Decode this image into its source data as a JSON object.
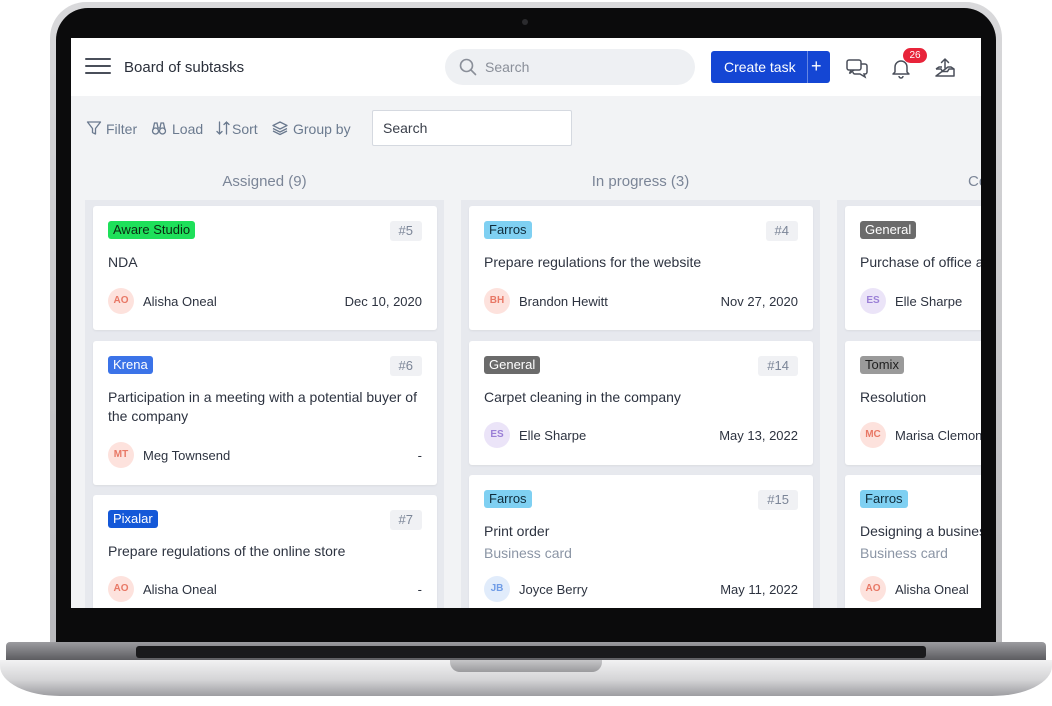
{
  "header": {
    "title": "Board of subtasks",
    "search_placeholder": "Search",
    "create_task_label": "Create task",
    "create_task_plus": "+",
    "notification_count": "26"
  },
  "toolbar": {
    "filter_label": "Filter",
    "load_label": "Load",
    "sort_label": "Sort",
    "group_by_label": "Group by",
    "search_placeholder": "Search"
  },
  "columns": [
    {
      "title": "Assigned (9)",
      "cards": [
        {
          "tag": "Aware Studio",
          "tag_color": "#1ee05a",
          "tag_text_color": "#0b2a12",
          "number": "#5",
          "title": "NDA",
          "subtitle": "",
          "initials": "AO",
          "person": "Alisha Oneal",
          "date": "Dec 10, 2020"
        },
        {
          "tag": "Krena",
          "tag_color": "#3b73e8",
          "tag_text_color": "#ffffff",
          "number": "#6",
          "title": "Participation in a meeting with a potential buyer of the company",
          "subtitle": "",
          "initials": "MT",
          "person": "Meg Townsend",
          "date": "-"
        },
        {
          "tag": "Pixalar",
          "tag_color": "#1458d8",
          "tag_text_color": "#ffffff",
          "number": "#7",
          "title": "Prepare regulations of the online store",
          "subtitle": "",
          "initials": "AO",
          "person": "Alisha Oneal",
          "date": "-"
        }
      ]
    },
    {
      "title": "In progress (3)",
      "cards": [
        {
          "tag": "Farros",
          "tag_color": "#7fd0f2",
          "tag_text_color": "#0f2b3a",
          "number": "#4",
          "title": "Prepare regulations for the website",
          "subtitle": "",
          "initials": "BH",
          "person": "Brandon Hewitt",
          "date": "Nov 27, 2020"
        },
        {
          "tag": "General",
          "tag_color": "#6b6b6b",
          "tag_text_color": "#ffffff",
          "number": "#14",
          "title": "Carpet cleaning in the company",
          "subtitle": "",
          "initials": "ES",
          "person": "Elle Sharpe",
          "date": "May 13, 2022"
        },
        {
          "tag": "Farros",
          "tag_color": "#7fd0f2",
          "tag_text_color": "#0f2b3a",
          "number": "#15",
          "title": "Print order",
          "subtitle": "Business card",
          "initials": "JB",
          "person": "Joyce Berry",
          "date": "May 11, 2022"
        }
      ]
    },
    {
      "title": "Co",
      "cards": [
        {
          "tag": "General",
          "tag_color": "#6b6b6b",
          "tag_text_color": "#ffffff",
          "number": "",
          "title": "Purchase of office ac",
          "subtitle": "",
          "initials": "ES",
          "person": "Elle Sharpe",
          "date": ""
        },
        {
          "tag": "Tomix",
          "tag_color": "#9a9a9a",
          "tag_text_color": "#1f1f1f",
          "number": "",
          "title": "Resolution",
          "subtitle": "",
          "initials": "MC",
          "person": "Marisa Clemons",
          "date": ""
        },
        {
          "tag": "Farros",
          "tag_color": "#7fd0f2",
          "tag_text_color": "#0f2b3a",
          "number": "",
          "title": "Designing a busines",
          "subtitle": "Business card",
          "initials": "AO",
          "person": "Alisha Oneal",
          "date": ""
        }
      ]
    }
  ]
}
